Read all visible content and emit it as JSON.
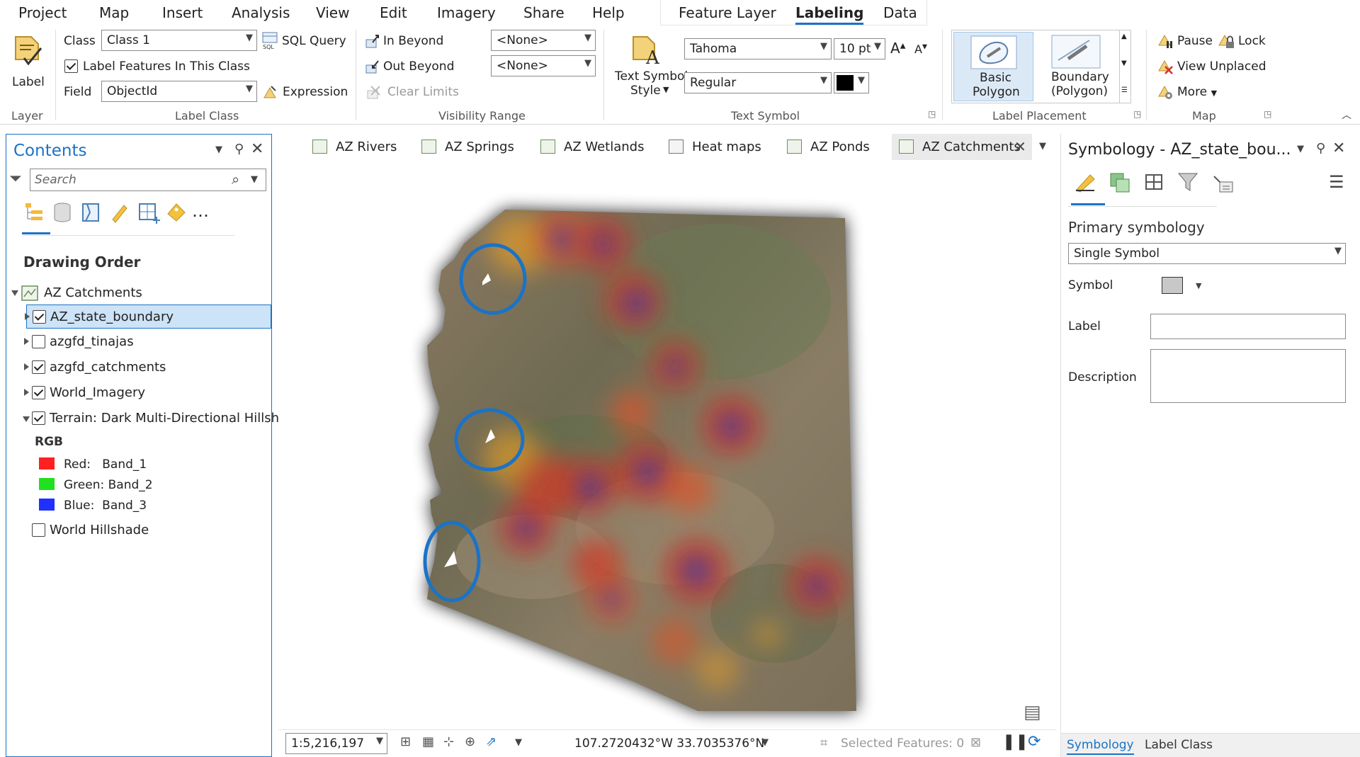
{
  "menubar": {
    "tabs": [
      "Project",
      "Map",
      "Insert",
      "Analysis",
      "View",
      "Edit",
      "Imagery",
      "Share",
      "Help"
    ],
    "context_tabs": [
      "Feature Layer",
      "Labeling",
      "Data"
    ],
    "active_tab": "Labeling"
  },
  "ribbon": {
    "layer": {
      "button_label": "Label",
      "group_label": "Layer"
    },
    "label_class": {
      "class_label": "Class",
      "class_value": "Class 1",
      "sql_query": "SQL Query",
      "label_features": "Label Features In This Class",
      "field_label": "Field",
      "field_value": "ObjectId",
      "expression": "Expression",
      "group_label": "Label Class"
    },
    "visibility_range": {
      "in_beyond": "In Beyond",
      "out_beyond": "Out Beyond",
      "clear_limits": "Clear Limits",
      "in_value": "<None>",
      "out_value": "<None>",
      "group_label": "Visibility Range"
    },
    "text_symbol": {
      "style_label": "Text Symbol",
      "style_label2": "Style",
      "font": "Tahoma",
      "size": "10 pt",
      "style": "Regular",
      "color": "#000000",
      "group_label": "Text Symbol"
    },
    "label_placement": {
      "basic": "Basic",
      "basic2": "Polygon",
      "boundary": "Boundary",
      "boundary2": "(Polygon)",
      "group_label": "Label Placement"
    },
    "map": {
      "pause": "Pause",
      "lock": "Lock",
      "view_unplaced": "View Unplaced",
      "more": "More",
      "group_label": "Map"
    }
  },
  "contents": {
    "title": "Contents",
    "search_placeholder": "Search",
    "section_title": "Drawing Order",
    "map_name": "AZ Catchments",
    "layers": [
      {
        "name": "AZ_state_boundary",
        "checked": true,
        "selected": true
      },
      {
        "name": "azgfd_tinajas",
        "checked": false
      },
      {
        "name": "azgfd_catchments",
        "checked": true
      },
      {
        "name": "World_Imagery",
        "checked": true
      },
      {
        "name": "Terrain: Dark Multi-Directional Hillsh...",
        "checked": true
      }
    ],
    "rgb_label": "RGB",
    "bands": [
      {
        "label": "Red:   Band_1",
        "color": "#ff2020"
      },
      {
        "label": "Green: Band_2",
        "color": "#20e020"
      },
      {
        "label": "Blue:  Band_3",
        "color": "#2030ff"
      }
    ],
    "world_hillshade": "World Hillshade"
  },
  "map_tabs": [
    {
      "name": "AZ Rivers",
      "active": false
    },
    {
      "name": "AZ Springs",
      "active": false
    },
    {
      "name": "AZ Wetlands",
      "active": false
    },
    {
      "name": "Heat maps",
      "active": false
    },
    {
      "name": "AZ Ponds",
      "active": false
    },
    {
      "name": "AZ Catchments",
      "active": true
    }
  ],
  "statusbar": {
    "scale": "1:5,216,197",
    "coordinates": "107.2720432°W 33.7035376°N",
    "selected_features": "Selected Features: 0"
  },
  "symbology": {
    "title": "Symbology - AZ_state_bou...",
    "primary_heading": "Primary symbology",
    "primary_value": "Single Symbol",
    "symbol_label": "Symbol",
    "label_label": "Label",
    "label_value": "",
    "description_label": "Description",
    "description_value": "",
    "bottom_tabs": [
      "Symbology",
      "Label Class"
    ],
    "symbol_fill": "#c8c8c8"
  },
  "colors": {
    "accent": "#1a73c7",
    "selection": "#cde3f7"
  }
}
